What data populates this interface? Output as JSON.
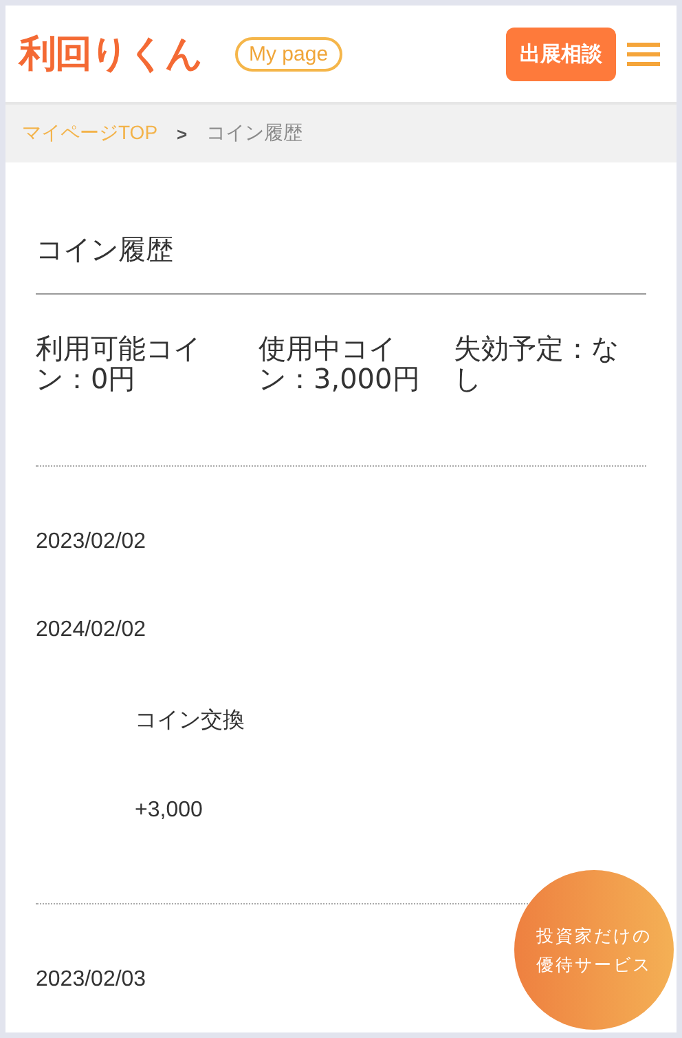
{
  "header": {
    "logo": "利回りくん",
    "mypage": "My page",
    "consult_button": "出展相談"
  },
  "breadcrumb": [
    {
      "label": "マイページTOP",
      "link": true
    },
    {
      "label": "コイン履歴",
      "link": false
    }
  ],
  "breadcrumb_separator": ">",
  "title": "コイン履歴",
  "summary": [
    "利用可能コイン：0円",
    "使用中コイン：3,000円",
    "失効予定：なし"
  ],
  "history": [
    {
      "dates": [
        "2023/02/02",
        "2024/02/02"
      ],
      "type": "コイン交換",
      "amount": "+3,000"
    },
    {
      "dates": [
        "2023/02/03"
      ]
    }
  ],
  "badge": [
    "投資家だけの",
    "優待サービス"
  ]
}
